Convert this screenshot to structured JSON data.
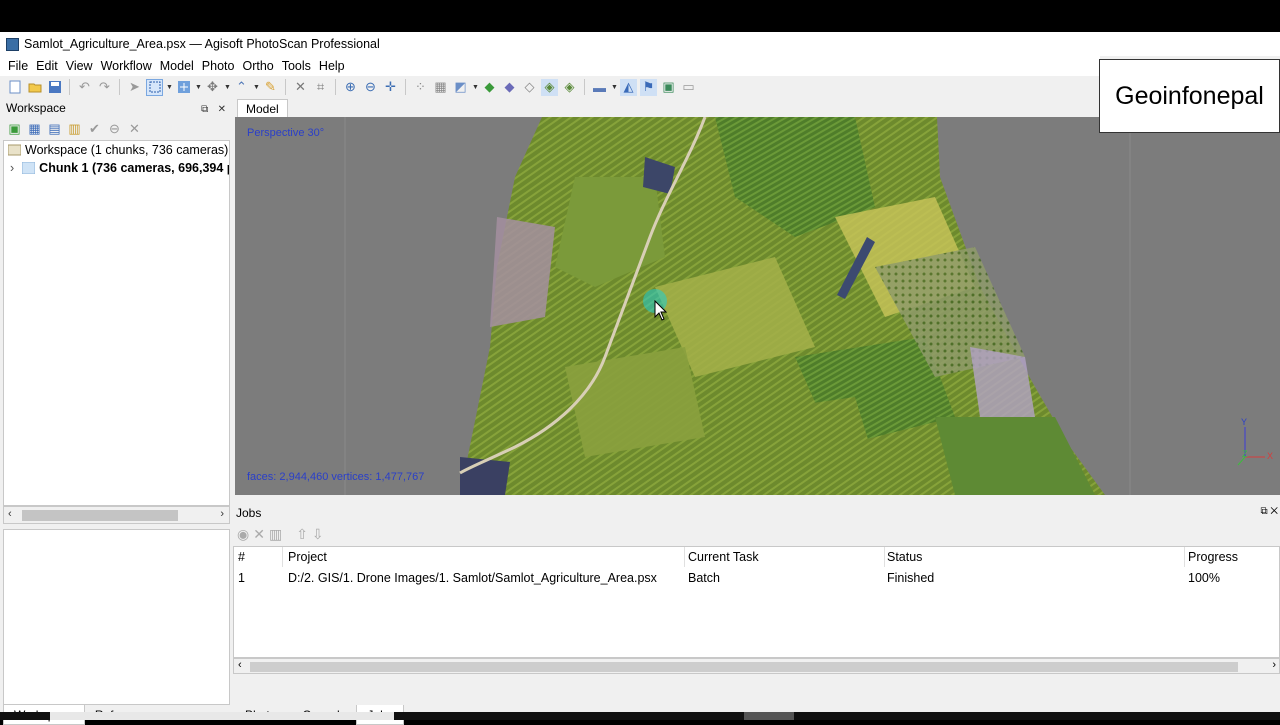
{
  "window": {
    "title": "Samlot_Agriculture_Area.psx — Agisoft PhotoScan Professional"
  },
  "menu": [
    "File",
    "Edit",
    "View",
    "Workflow",
    "Model",
    "Photo",
    "Ortho",
    "Tools",
    "Help"
  ],
  "watermark": "Geoinfonepal",
  "workspace": {
    "panel_title": "Workspace",
    "root_label": "Workspace (1 chunks, 736 cameras)",
    "chunk_label": "Chunk 1 (736 cameras, 696,394 p"
  },
  "model_view": {
    "tab_label": "Model",
    "perspective_label": "Perspective 30°",
    "stats_label": "faces: 2,944,460 vertices: 1,477,767",
    "axis_y": "Y",
    "axis_x": "X",
    "axis_z": "Z"
  },
  "jobs": {
    "panel_title": "Jobs",
    "columns": [
      "#",
      "Project",
      "Current Task",
      "Status",
      "Progress"
    ],
    "rows": [
      {
        "num": "1",
        "project": "D:/2. GIS/1. Drone Images/1. Samlot/Samlot_Agriculture_Area.psx",
        "task": "Batch",
        "status": "Finished",
        "progress": "100%"
      }
    ]
  },
  "left_tabs": [
    "Workspace",
    "Reference"
  ],
  "bottom_tabs": [
    "Photos",
    "Console",
    "Jobs"
  ],
  "colors": {
    "viewport_bg": "#7c7c7c",
    "label_blue": "#2a3fc9",
    "field_green": "#6f8f2f"
  }
}
